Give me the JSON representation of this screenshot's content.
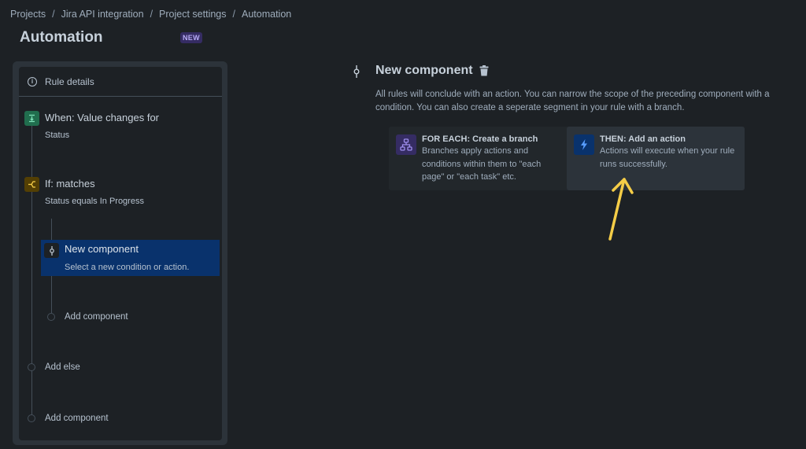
{
  "breadcrumb": [
    {
      "label": "Projects"
    },
    {
      "label": "Jira API integration"
    },
    {
      "label": "Project settings"
    },
    {
      "label": "Automation"
    }
  ],
  "breadcrumb_separator": "/",
  "page": {
    "title": "Automation",
    "badge": "NEW"
  },
  "rule_panel": {
    "rule_details_label": "Rule details",
    "trigger": {
      "title": "When: Value changes for",
      "subtitle": "Status",
      "icon": "trigger-icon",
      "color": "#216e4e"
    },
    "condition": {
      "title": "If: matches",
      "subtitle": "Status equals In Progress",
      "icon": "branch-condition-icon",
      "color": "#533f04"
    },
    "selected_component": {
      "title": "New component",
      "subtitle": "Select a new condition or action.",
      "icon": "component-icon",
      "color": "#09326c"
    },
    "add_component_inner": "Add component",
    "add_else": "Add else",
    "add_component_outer": "Add component"
  },
  "main": {
    "title": "New component",
    "description": "All rules will conclude with an action. You can narrow the scope of the preceding component with a condition. You can also create a seperate segment in your rule with a branch.",
    "options": [
      {
        "title": "FOR EACH: Create a branch",
        "description": "Branches apply actions and conditions within them to \"each page\" or \"each task\" etc.",
        "icon": "branch-tree-icon",
        "icon_bg": "#352c63",
        "icon_color": "#9f8fef"
      },
      {
        "title": "THEN: Add an action",
        "description": "Actions will execute when your rule runs successfully.",
        "icon": "lightning-icon",
        "icon_bg": "#09326c",
        "icon_color": "#579dff"
      }
    ]
  },
  "annotation": {
    "arrow_color": "#f5cd47"
  }
}
